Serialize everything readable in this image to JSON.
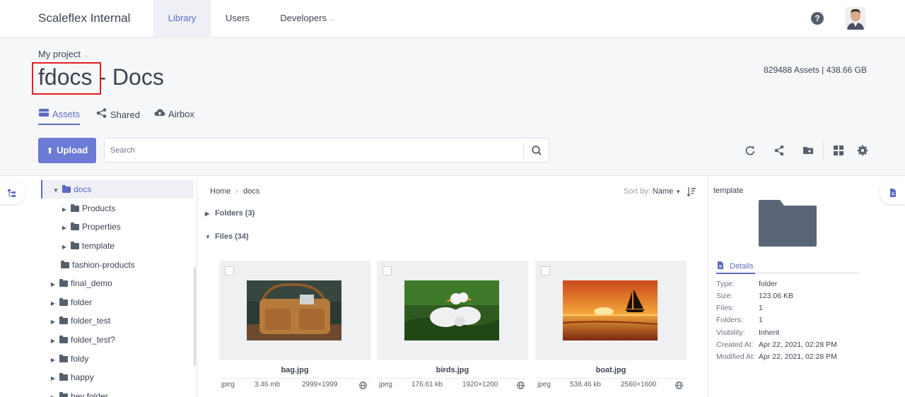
{
  "app": {
    "brand": "Scaleflex Internal"
  },
  "nav": {
    "tabs": [
      {
        "label": "Library"
      },
      {
        "label": "Users"
      },
      {
        "label": "Developers"
      }
    ],
    "help_label": "?"
  },
  "header": {
    "project": "My project",
    "title_highlight": "fdocs",
    "title_rest": " - Docs",
    "stats": "829488 Assets | 438.66 GB",
    "subtabs": [
      {
        "label": "Assets",
        "icon": "drawer-icon"
      },
      {
        "label": "Shared",
        "icon": "share-icon"
      },
      {
        "label": "Airbox",
        "icon": "cloud-upload-icon"
      }
    ]
  },
  "toolbar": {
    "upload_label": "Upload",
    "search_placeholder": "Search",
    "tools": [
      "refresh-icon",
      "share-icon",
      "new-folder-icon",
      "grid-view-icon",
      "settings-icon"
    ]
  },
  "tree": {
    "items": [
      {
        "label": "docs",
        "expanded": true,
        "selected": true
      },
      {
        "label": "Products"
      },
      {
        "label": "Properties"
      },
      {
        "label": "template"
      },
      {
        "label": "fashion-products"
      },
      {
        "label": "final_demo"
      },
      {
        "label": "folder"
      },
      {
        "label": "folder_test"
      },
      {
        "label": "folder_test?"
      },
      {
        "label": "foldy"
      },
      {
        "label": "happy"
      },
      {
        "label": "hey folder"
      }
    ]
  },
  "main": {
    "breadcrumb": [
      "Home",
      "docs"
    ],
    "sort_label": "Sort by:",
    "sort_value": "Name",
    "folders_section": "Folders (3)",
    "files_section": "Files (34)",
    "files": [
      {
        "name": "bag.jpg",
        "type": "jpeg",
        "size": "3.46 mb",
        "dimensions": "2999×1999"
      },
      {
        "name": "birds.jpg",
        "type": "jpeg",
        "size": "176.61 kb",
        "dimensions": "1920×1200"
      },
      {
        "name": "boat.jpg",
        "type": "jpeg",
        "size": "538.46 kb",
        "dimensions": "2560×1600"
      }
    ]
  },
  "detail": {
    "name": "template",
    "tab_label": "Details",
    "fields": [
      {
        "key": "Type:",
        "value": "folder"
      },
      {
        "key": "Size:",
        "value": "123.06 KB"
      },
      {
        "key": "Files:",
        "value": "1"
      },
      {
        "key": "Folders:",
        "value": "1"
      },
      {
        "key": "Visibility:",
        "value": "Inherit"
      },
      {
        "key": "Created At:",
        "value": "Apr 22, 2021, 02:28 PM"
      },
      {
        "key": "Modified At:",
        "value": "Apr 22, 2021, 02:28 PM"
      }
    ]
  },
  "colors": {
    "accent": "#5c6bc0",
    "upload": "#6b7bd6",
    "highlight_box": "#e02020",
    "folder": "#55606e"
  }
}
